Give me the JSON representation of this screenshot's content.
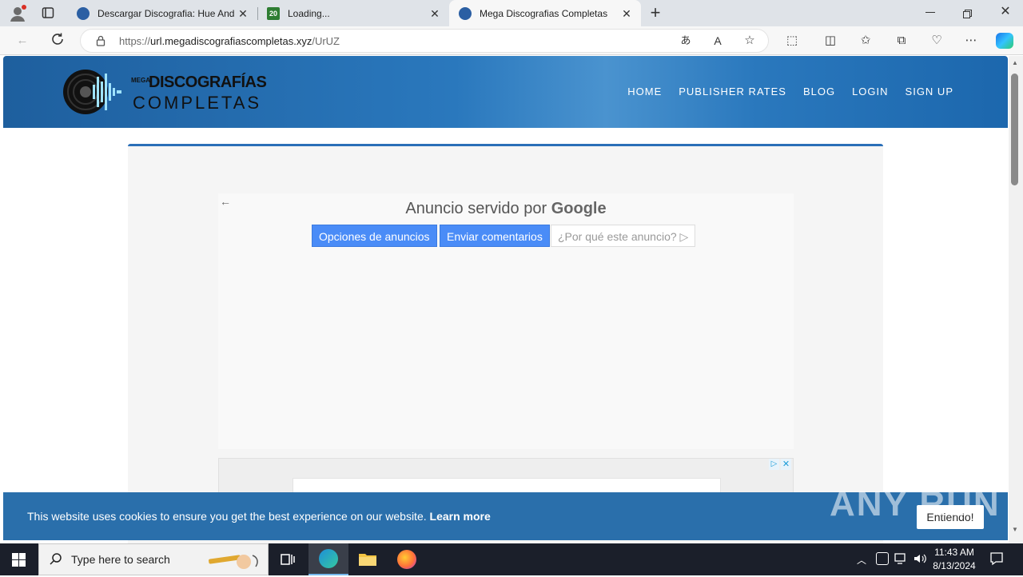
{
  "browser": {
    "tabs": [
      {
        "title": "Descargar Discografia: Hue And (",
        "favicon_color": "#2b5fa3"
      },
      {
        "title": "Loading...",
        "favicon_text": "20",
        "favicon_color": "#2e7d32"
      },
      {
        "title": "Mega Discografias Completas",
        "favicon_color": "#2b5fa3",
        "active": true
      }
    ],
    "url": {
      "scheme": "https://",
      "host": "url.megadiscografiascompletas.xyz",
      "path": "/UrUZ"
    }
  },
  "site": {
    "logo": {
      "top": "MEGA",
      "main": "DISCOGRAFÍAS",
      "sub": "COMPLETAS"
    },
    "nav": [
      "HOME",
      "PUBLISHER RATES",
      "BLOG",
      "LOGIN",
      "SIGN UP"
    ]
  },
  "ad": {
    "title_prefix": "Anuncio servido por",
    "title_brand": "Google",
    "buttons": [
      "Opciones de anuncios",
      "Enviar comentarios",
      "¿Por qué este anuncio?"
    ]
  },
  "cookie": {
    "text": "This website uses cookies to ensure you get the best experience on our website.",
    "link": "Learn more",
    "button": "Entiendo!"
  },
  "watermark": "ANY RUN",
  "taskbar": {
    "search_placeholder": "Type here to search",
    "time": "11:43 AM",
    "date": "8/13/2024"
  }
}
